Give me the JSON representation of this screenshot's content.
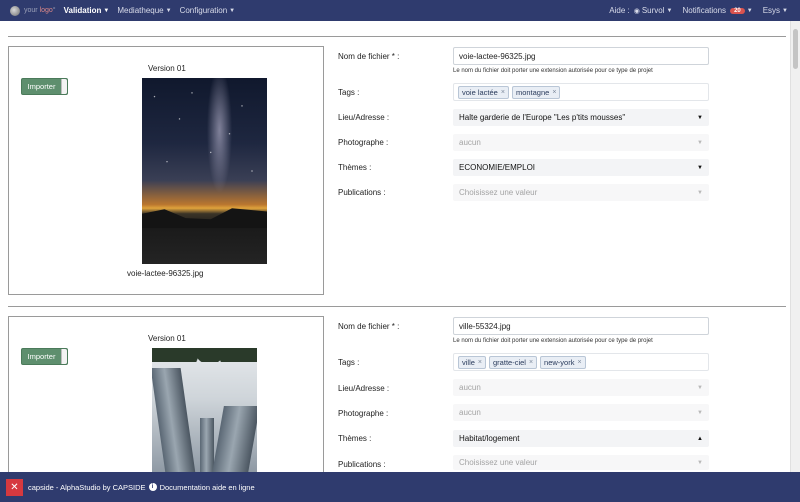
{
  "nav": {
    "brand": {
      "prefix": "your ",
      "accent": "logo",
      "suffix": "°"
    },
    "items": [
      {
        "label": "Validation",
        "active": true
      },
      {
        "label": "Mediatheque",
        "active": false
      },
      {
        "label": "Configuration",
        "active": false
      }
    ],
    "right": {
      "aide": "Aide :",
      "survol": "Survol",
      "notifications_label": "Notifications",
      "notifications_count": "20",
      "user": "Esys"
    }
  },
  "media": [
    {
      "import_label": "Importer",
      "version": "Version 01",
      "filename_caption": "voie-lactee-96325.jpg",
      "form": {
        "filename_label": "Nom de fichier * :",
        "filename_value": "voie-lactee-96325.jpg",
        "filename_help": "Le nom du fichier doit porter une extension autorisée pour ce type de projet",
        "tags_label": "Tags :",
        "tags": [
          "voie lactée",
          "montagne"
        ],
        "place_label": "Lieu/Adresse :",
        "place_value": "Halte garderie de l'Europe \"Les p'tits mousses\"",
        "photographer_label": "Photographe :",
        "photographer_value": "aucun",
        "themes_label": "Thèmes :",
        "themes_value": "ECONOMIE/EMPLOI",
        "publications_label": "Publications :",
        "publications_value": "Choisissez une valeur"
      }
    },
    {
      "import_label": "Importer",
      "version": "Version 01",
      "form": {
        "filename_label": "Nom de fichier * :",
        "filename_value": "ville-55324.jpg",
        "filename_help": "Le nom du fichier doit porter une extension autorisée pour ce type de projet",
        "tags_label": "Tags :",
        "tags": [
          "ville",
          "gratte-ciel",
          "new-york"
        ],
        "place_label": "Lieu/Adresse :",
        "place_value": "aucun",
        "photographer_label": "Photographe :",
        "photographer_value": "aucun",
        "themes_label": "Thèmes :",
        "themes_value": "Habitat/logement",
        "publications_label": "Publications :",
        "publications_value": "Choisissez une valeur"
      }
    }
  ],
  "footer": {
    "logo_glyph": "✕",
    "text": "capside - AlphaStudio by CAPSIDE",
    "doc_link": "Documentation aide en ligne"
  },
  "colors": {
    "navbar": "#2f3b6e",
    "import_button": "#5e8f6e",
    "notification_badge": "#d9534f",
    "footer_logo": "#d6393f"
  }
}
